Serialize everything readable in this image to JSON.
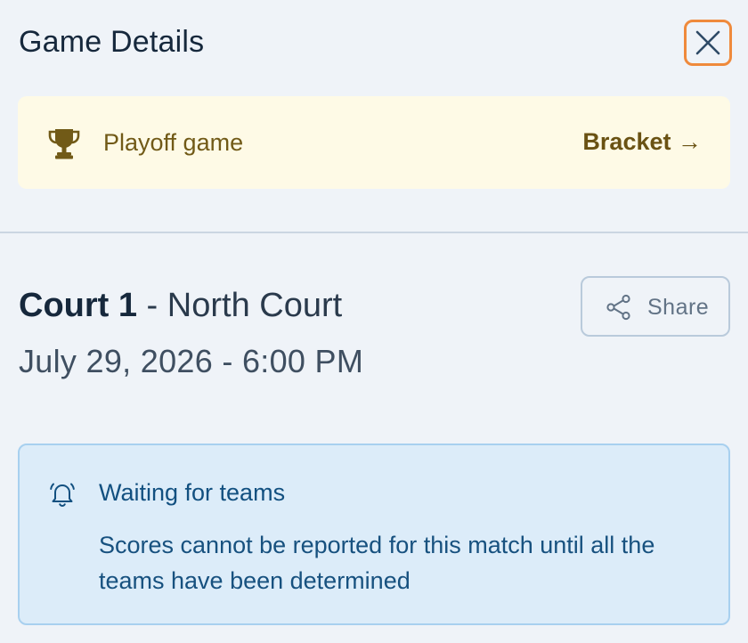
{
  "header": {
    "title": "Game Details",
    "close_icon": "close-icon"
  },
  "banner": {
    "icon": "trophy-icon",
    "label": "Playoff game",
    "link_label": "Bracket →"
  },
  "game": {
    "court_name": "Court 1",
    "separator": " - ",
    "court_location": "North Court",
    "datetime": "July 29, 2026 - 6:00 PM",
    "share_label": "Share",
    "share_icon": "share-icon"
  },
  "alert": {
    "icon": "bell-icon",
    "title": "Waiting for teams",
    "body": "Scores cannot be reported for this match until all the teams have been determined"
  },
  "colors": {
    "background": "#eff3f8",
    "banner_bg": "#fefae6",
    "banner_text": "#715a17",
    "close_focus_ring": "#ef8a3c",
    "alert_bg": "#dcecf9",
    "alert_border": "#a8d0ef",
    "alert_text": "#125080"
  }
}
